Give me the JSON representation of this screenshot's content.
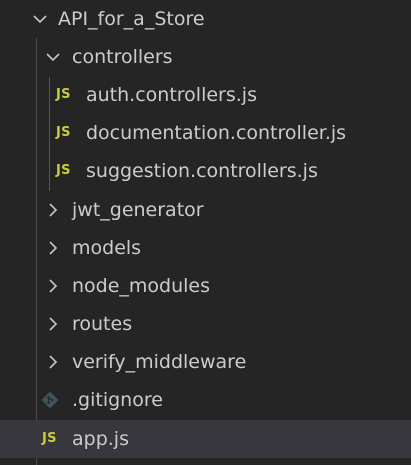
{
  "explorer": {
    "root": {
      "label": "API_for_a_Store",
      "expanded": true
    },
    "items": [
      {
        "label": "controllers",
        "type": "folder",
        "expanded": true
      },
      {
        "label": "auth.controllers.js",
        "type": "file",
        "badge": "JS"
      },
      {
        "label": "documentation.controller.js",
        "type": "file",
        "badge": "JS"
      },
      {
        "label": "suggestion.controllers.js",
        "type": "file",
        "badge": "JS"
      },
      {
        "label": "jwt_generator",
        "type": "folder",
        "expanded": false
      },
      {
        "label": "models",
        "type": "folder",
        "expanded": false
      },
      {
        "label": "node_modules",
        "type": "folder",
        "expanded": false
      },
      {
        "label": "routes",
        "type": "folder",
        "expanded": false
      },
      {
        "label": "verify_middleware",
        "type": "folder",
        "expanded": false
      },
      {
        "label": ".gitignore",
        "type": "file",
        "icon": "git-icon"
      },
      {
        "label": "app.js",
        "type": "file",
        "badge": "JS",
        "selected": true
      }
    ]
  },
  "colors": {
    "background": "#252526",
    "selected_row": "#37373d",
    "text": "#cccccc",
    "js_badge": "#cbcb41",
    "git_icon": "#41535b"
  }
}
